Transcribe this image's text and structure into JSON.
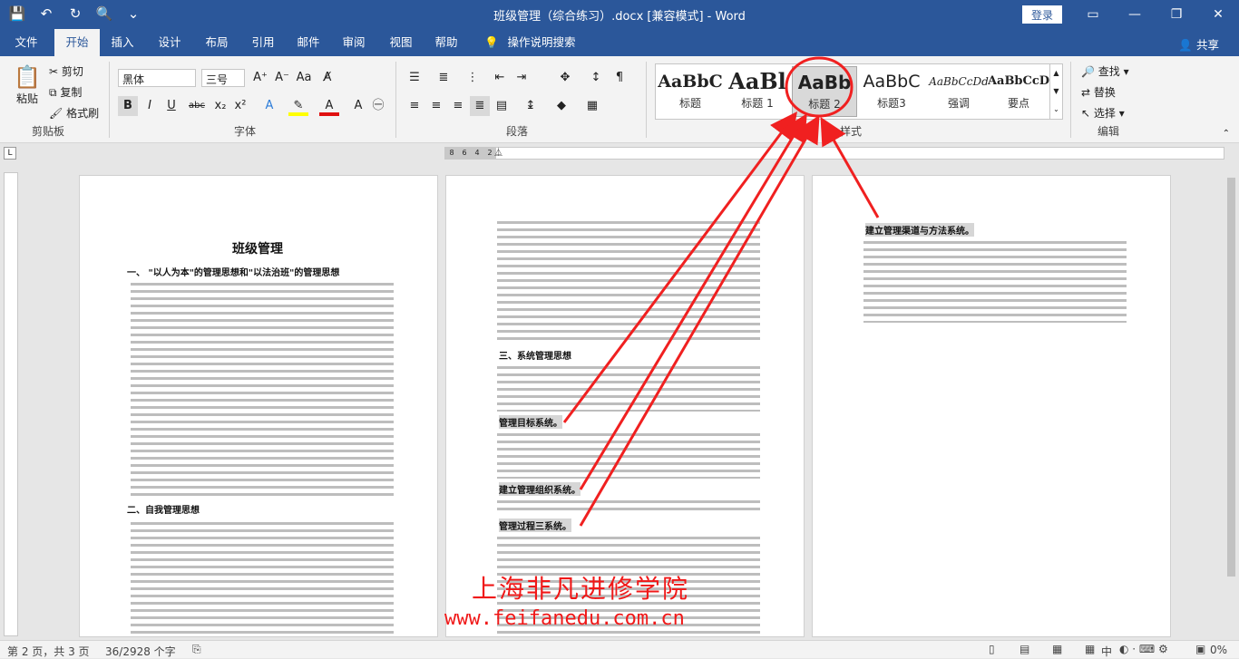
{
  "window": {
    "title": "班级管理（综合练习）.docx [兼容模式] - Word",
    "login": "登录"
  },
  "tabs": [
    "文件",
    "开始",
    "插入",
    "设计",
    "布局",
    "引用",
    "邮件",
    "审阅",
    "视图",
    "帮助"
  ],
  "tell_me": "操作说明搜索",
  "share": "共享",
  "clipboard": {
    "paste": "粘贴",
    "cut": "剪切",
    "copy": "复制",
    "format_painter": "格式刷",
    "label": "剪贴板"
  },
  "font": {
    "name": "黑体",
    "size": "三号",
    "label": "字体"
  },
  "paragraph": {
    "label": "段落"
  },
  "styles": {
    "label": "样式",
    "items": [
      {
        "preview": "AaBbC",
        "name": "标题"
      },
      {
        "preview": "AaBl",
        "name": "标题 1"
      },
      {
        "preview": "AaBb",
        "name": "标题 2"
      },
      {
        "preview": "AaBbC",
        "name": "标题3"
      },
      {
        "preview": "AaBbCcDd",
        "name": "强调"
      },
      {
        "preview": "AaBbCcD",
        "name": "要点"
      }
    ]
  },
  "editing": {
    "find": "查找",
    "replace": "替换",
    "select": "选择",
    "label": "编辑"
  },
  "ruler_marks": [
    "8",
    "6",
    "4",
    "2"
  ],
  "pages": {
    "p1": {
      "title": "班级管理",
      "h1": "一、 \"以人为本\"的管理思想和\"以法治班\"的管理思想",
      "h2": "二、自我管理思想"
    },
    "p2": {
      "h3": "三、系统管理思想",
      "s1": "管理目标系统。",
      "s2": "建立管理组织系统。",
      "s3": "管理过程三系统。"
    },
    "p3": {
      "s4": "建立管理渠道与方法系统。"
    }
  },
  "watermark": {
    "line1": "上海非凡进修学院",
    "line2": "www.feifanedu.com.cn"
  },
  "status": {
    "page": "第 2 页，共 3 页",
    "words": "36/2928 个字",
    "lang": "中",
    "zoom": "0%"
  }
}
